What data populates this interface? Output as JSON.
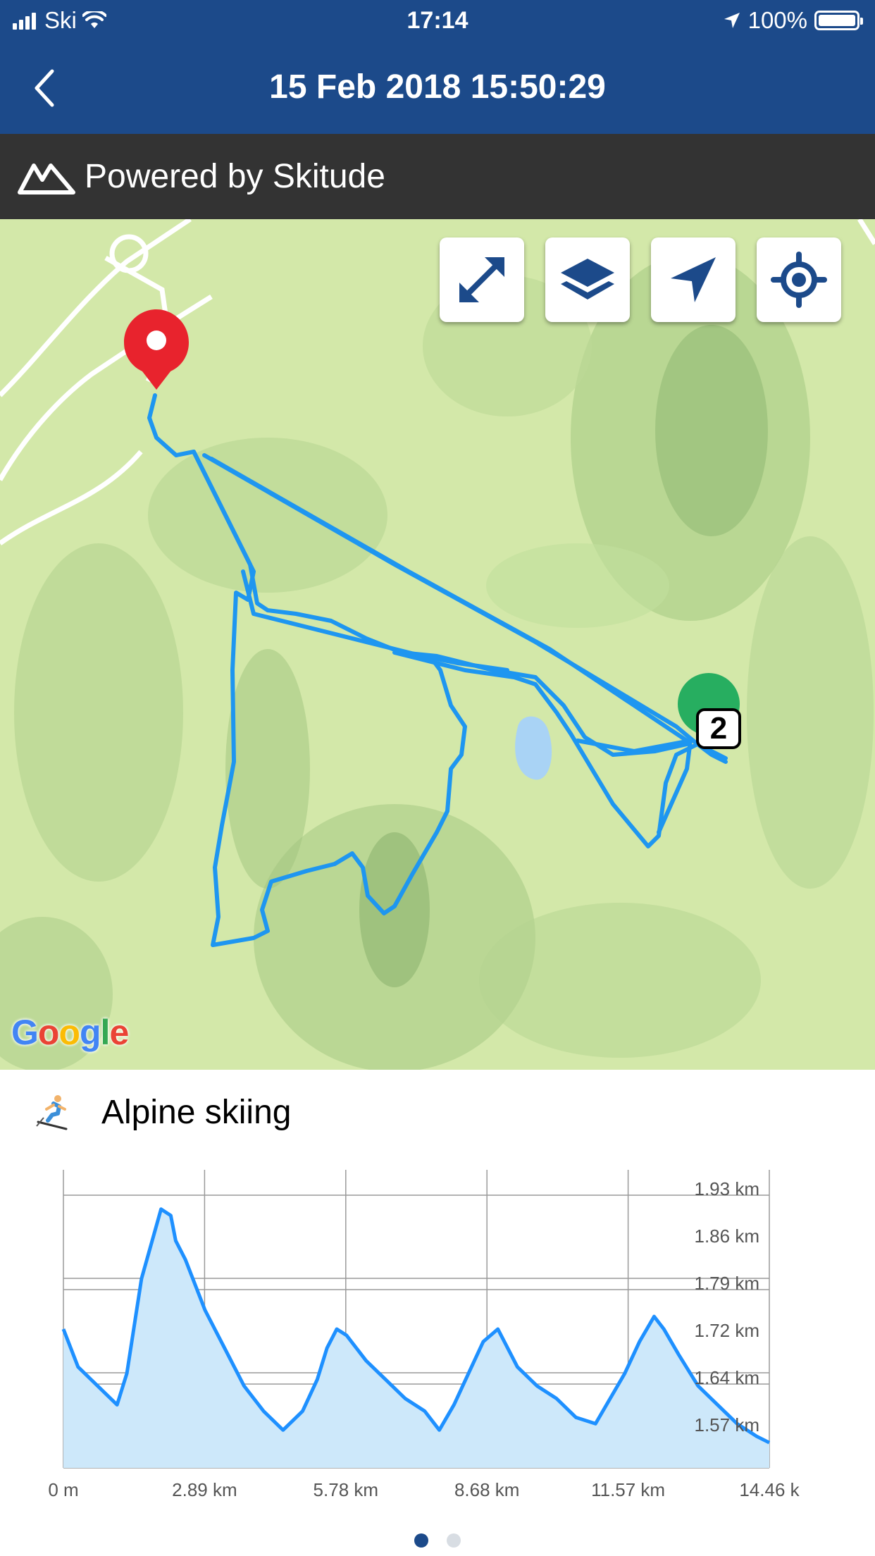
{
  "status_bar": {
    "carrier": "Ski",
    "time": "17:14",
    "battery": "100%"
  },
  "nav": {
    "title": "15 Feb 2018 15:50:29"
  },
  "banner": {
    "text": "Powered by Skitude"
  },
  "map": {
    "buttons": [
      "expand-icon",
      "layers-icon",
      "navigation-arrow-icon",
      "locate-icon"
    ],
    "accent_color": "#1c4a8a",
    "track_color": "#1e90ff",
    "start_marker_color": "#e53935",
    "end_marker_color": "#27ae60",
    "badge": "2",
    "attribution": "Google"
  },
  "activity": {
    "icon": "skier-icon",
    "label": "Alpine skiing"
  },
  "chart_data": {
    "type": "area",
    "xlabel": "",
    "ylabel": "",
    "x_tick_labels": [
      "0 m",
      "2.89 km",
      "5.78 km",
      "8.68 km",
      "11.57 km",
      "14.46 k"
    ],
    "y_tick_labels": [
      "1.93 km",
      "1.86 km",
      "1.79 km",
      "1.72 km",
      "1.64 km",
      "1.57 km"
    ],
    "xlim": [
      0,
      14.46
    ],
    "ylim": [
      1.5,
      1.95
    ],
    "x_km": [
      0,
      0.3,
      0.7,
      1.1,
      1.3,
      1.6,
      2.0,
      2.2,
      2.3,
      2.5,
      2.7,
      2.9,
      3.3,
      3.7,
      4.1,
      4.5,
      4.9,
      5.2,
      5.4,
      5.6,
      5.8,
      6.2,
      6.6,
      7.0,
      7.4,
      7.7,
      8.0,
      8.3,
      8.6,
      8.9,
      9.3,
      9.7,
      10.1,
      10.5,
      10.9,
      11.2,
      11.5,
      11.8,
      12.1,
      12.3,
      12.6,
      13.0,
      13.4,
      13.8,
      14.2,
      14.46
    ],
    "y_km": [
      1.72,
      1.66,
      1.63,
      1.6,
      1.65,
      1.8,
      1.91,
      1.9,
      1.86,
      1.83,
      1.79,
      1.75,
      1.69,
      1.63,
      1.59,
      1.56,
      1.59,
      1.64,
      1.69,
      1.72,
      1.71,
      1.67,
      1.64,
      1.61,
      1.59,
      1.56,
      1.6,
      1.65,
      1.7,
      1.72,
      1.66,
      1.63,
      1.61,
      1.58,
      1.57,
      1.61,
      1.65,
      1.7,
      1.74,
      1.72,
      1.68,
      1.63,
      1.6,
      1.57,
      1.55,
      1.54
    ],
    "line_color": "#1e90ff",
    "fill_color": "#cde8fa",
    "grid": true
  },
  "pager": {
    "active_color": "#1c4a8a",
    "inactive_color": "#d8dde3"
  }
}
